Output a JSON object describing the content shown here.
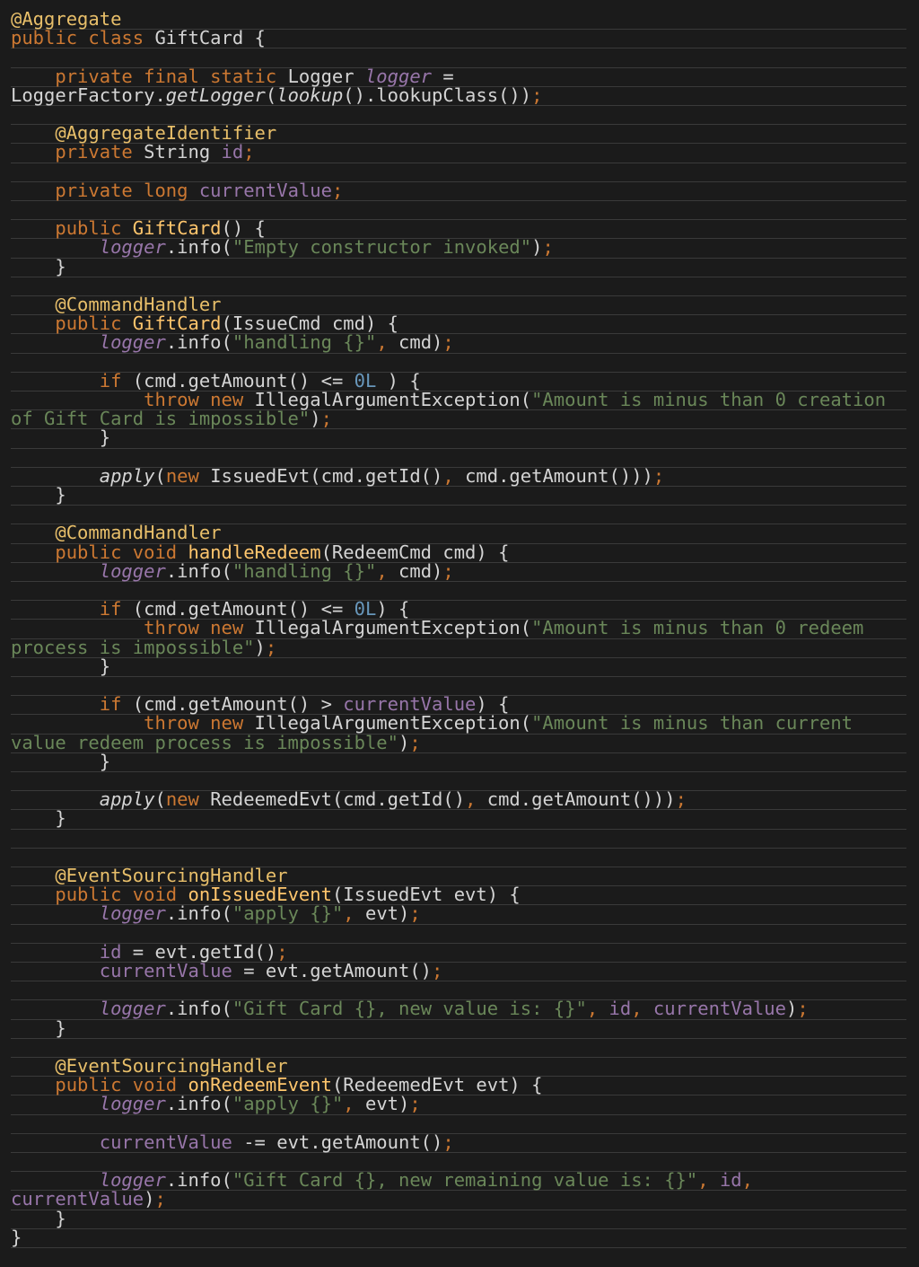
{
  "editor": {
    "language": "java",
    "theme": {
      "background": "#1b1b1b",
      "rule": "#3a3a3a",
      "plain": "#d4d4d4",
      "keyword": "#cc7832",
      "annotation": "#e8bf6a",
      "method_decl": "#ffc66d",
      "field": "#9876aa",
      "string": "#6a8759",
      "number": "#6897bb"
    },
    "lines": [
      [
        {
          "t": "ann",
          "s": "@Aggregate"
        }
      ],
      [
        {
          "t": "kw",
          "s": "public class "
        },
        {
          "t": "plain",
          "s": "GiftCard {"
        }
      ],
      [],
      [
        {
          "t": "plain",
          "s": "    "
        },
        {
          "t": "kw",
          "s": "private final static "
        },
        {
          "t": "plain",
          "s": "Logger "
        },
        {
          "t": "static",
          "s": "logger"
        },
        {
          "t": "plain",
          "s": " ="
        }
      ],
      [
        {
          "t": "plain",
          "s": "LoggerFactory."
        },
        {
          "t": "ital",
          "s": "getLogger"
        },
        {
          "t": "plain",
          "s": "("
        },
        {
          "t": "ital",
          "s": "lookup"
        },
        {
          "t": "plain",
          "s": "().lookupClass())"
        },
        {
          "t": "punct",
          "s": ";"
        }
      ],
      [],
      [
        {
          "t": "plain",
          "s": "    "
        },
        {
          "t": "ann",
          "s": "@AggregateIdentifier"
        }
      ],
      [
        {
          "t": "plain",
          "s": "    "
        },
        {
          "t": "kw",
          "s": "private "
        },
        {
          "t": "plain",
          "s": "String "
        },
        {
          "t": "field",
          "s": "id"
        },
        {
          "t": "punct",
          "s": ";"
        }
      ],
      [],
      [
        {
          "t": "plain",
          "s": "    "
        },
        {
          "t": "kw",
          "s": "private long "
        },
        {
          "t": "field",
          "s": "currentValue"
        },
        {
          "t": "punct",
          "s": ";"
        }
      ],
      [],
      [
        {
          "t": "plain",
          "s": "    "
        },
        {
          "t": "kw",
          "s": "public "
        },
        {
          "t": "fn",
          "s": "GiftCard"
        },
        {
          "t": "plain",
          "s": "() {"
        }
      ],
      [
        {
          "t": "plain",
          "s": "        "
        },
        {
          "t": "static",
          "s": "logger"
        },
        {
          "t": "plain",
          "s": ".info("
        },
        {
          "t": "str",
          "s": "\"Empty constructor invoked\""
        },
        {
          "t": "plain",
          "s": ")"
        },
        {
          "t": "punct",
          "s": ";"
        }
      ],
      [
        {
          "t": "plain",
          "s": "    }"
        }
      ],
      [],
      [
        {
          "t": "plain",
          "s": "    "
        },
        {
          "t": "ann",
          "s": "@CommandHandler"
        }
      ],
      [
        {
          "t": "plain",
          "s": "    "
        },
        {
          "t": "kw",
          "s": "public "
        },
        {
          "t": "fn",
          "s": "GiftCard"
        },
        {
          "t": "plain",
          "s": "(IssueCmd cmd) {"
        }
      ],
      [
        {
          "t": "plain",
          "s": "        "
        },
        {
          "t": "static",
          "s": "logger"
        },
        {
          "t": "plain",
          "s": ".info("
        },
        {
          "t": "str",
          "s": "\"handling {}\""
        },
        {
          "t": "punct",
          "s": ", "
        },
        {
          "t": "plain",
          "s": "cmd)"
        },
        {
          "t": "punct",
          "s": ";"
        }
      ],
      [],
      [
        {
          "t": "plain",
          "s": "        "
        },
        {
          "t": "kw",
          "s": "if "
        },
        {
          "t": "plain",
          "s": "(cmd.getAmount() <= "
        },
        {
          "t": "num",
          "s": "0L"
        },
        {
          "t": "plain",
          "s": " ) {"
        }
      ],
      [
        {
          "t": "plain",
          "s": "            "
        },
        {
          "t": "kw",
          "s": "throw new "
        },
        {
          "t": "plain",
          "s": "IllegalArgumentException("
        },
        {
          "t": "str",
          "s": "\"Amount is minus than 0 creation"
        }
      ],
      [
        {
          "t": "str",
          "s": "of Gift Card is impossible\""
        },
        {
          "t": "plain",
          "s": ")"
        },
        {
          "t": "punct",
          "s": ";"
        }
      ],
      [
        {
          "t": "plain",
          "s": "        }"
        }
      ],
      [],
      [
        {
          "t": "plain",
          "s": "        "
        },
        {
          "t": "ital",
          "s": "apply"
        },
        {
          "t": "plain",
          "s": "("
        },
        {
          "t": "kw",
          "s": "new "
        },
        {
          "t": "plain",
          "s": "IssuedEvt(cmd.getId()"
        },
        {
          "t": "punct",
          "s": ", "
        },
        {
          "t": "plain",
          "s": "cmd.getAmount()))"
        },
        {
          "t": "punct",
          "s": ";"
        }
      ],
      [
        {
          "t": "plain",
          "s": "    }"
        }
      ],
      [],
      [
        {
          "t": "plain",
          "s": "    "
        },
        {
          "t": "ann",
          "s": "@CommandHandler"
        }
      ],
      [
        {
          "t": "plain",
          "s": "    "
        },
        {
          "t": "kw",
          "s": "public void "
        },
        {
          "t": "fn",
          "s": "handleRedeem"
        },
        {
          "t": "plain",
          "s": "(RedeemCmd cmd) {"
        }
      ],
      [
        {
          "t": "plain",
          "s": "        "
        },
        {
          "t": "static",
          "s": "logger"
        },
        {
          "t": "plain",
          "s": ".info("
        },
        {
          "t": "str",
          "s": "\"handling {}\""
        },
        {
          "t": "punct",
          "s": ", "
        },
        {
          "t": "plain",
          "s": "cmd)"
        },
        {
          "t": "punct",
          "s": ";"
        }
      ],
      [],
      [
        {
          "t": "plain",
          "s": "        "
        },
        {
          "t": "kw",
          "s": "if "
        },
        {
          "t": "plain",
          "s": "(cmd.getAmount() <= "
        },
        {
          "t": "num",
          "s": "0L"
        },
        {
          "t": "plain",
          "s": ") {"
        }
      ],
      [
        {
          "t": "plain",
          "s": "            "
        },
        {
          "t": "kw",
          "s": "throw new "
        },
        {
          "t": "plain",
          "s": "IllegalArgumentException("
        },
        {
          "t": "str",
          "s": "\"Amount is minus than 0 redeem"
        }
      ],
      [
        {
          "t": "str",
          "s": "process is impossible\""
        },
        {
          "t": "plain",
          "s": ")"
        },
        {
          "t": "punct",
          "s": ";"
        }
      ],
      [
        {
          "t": "plain",
          "s": "        }"
        }
      ],
      [],
      [
        {
          "t": "plain",
          "s": "        "
        },
        {
          "t": "kw",
          "s": "if "
        },
        {
          "t": "plain",
          "s": "(cmd.getAmount() > "
        },
        {
          "t": "field",
          "s": "currentValue"
        },
        {
          "t": "plain",
          "s": ") {"
        }
      ],
      [
        {
          "t": "plain",
          "s": "            "
        },
        {
          "t": "kw",
          "s": "throw new "
        },
        {
          "t": "plain",
          "s": "IllegalArgumentException("
        },
        {
          "t": "str",
          "s": "\"Amount is minus than current"
        }
      ],
      [
        {
          "t": "str",
          "s": "value redeem process is impossible\""
        },
        {
          "t": "plain",
          "s": ")"
        },
        {
          "t": "punct",
          "s": ";"
        }
      ],
      [
        {
          "t": "plain",
          "s": "        }"
        }
      ],
      [],
      [
        {
          "t": "plain",
          "s": "        "
        },
        {
          "t": "ital",
          "s": "apply"
        },
        {
          "t": "plain",
          "s": "("
        },
        {
          "t": "kw",
          "s": "new "
        },
        {
          "t": "plain",
          "s": "RedeemedEvt(cmd.getId()"
        },
        {
          "t": "punct",
          "s": ", "
        },
        {
          "t": "plain",
          "s": "cmd.getAmount()))"
        },
        {
          "t": "punct",
          "s": ";"
        }
      ],
      [
        {
          "t": "plain",
          "s": "    }"
        }
      ],
      [],
      [],
      [
        {
          "t": "plain",
          "s": "    "
        },
        {
          "t": "ann",
          "s": "@EventSourcingHandler"
        }
      ],
      [
        {
          "t": "plain",
          "s": "    "
        },
        {
          "t": "kw",
          "s": "public void "
        },
        {
          "t": "fn",
          "s": "onIssuedEvent"
        },
        {
          "t": "plain",
          "s": "(IssuedEvt evt) {"
        }
      ],
      [
        {
          "t": "plain",
          "s": "        "
        },
        {
          "t": "static",
          "s": "logger"
        },
        {
          "t": "plain",
          "s": ".info("
        },
        {
          "t": "str",
          "s": "\"apply {}\""
        },
        {
          "t": "punct",
          "s": ", "
        },
        {
          "t": "plain",
          "s": "evt)"
        },
        {
          "t": "punct",
          "s": ";"
        }
      ],
      [],
      [
        {
          "t": "plain",
          "s": "        "
        },
        {
          "t": "field",
          "s": "id"
        },
        {
          "t": "plain",
          "s": " = evt.getId()"
        },
        {
          "t": "punct",
          "s": ";"
        }
      ],
      [
        {
          "t": "plain",
          "s": "        "
        },
        {
          "t": "field",
          "s": "currentValue"
        },
        {
          "t": "plain",
          "s": " = evt.getAmount()"
        },
        {
          "t": "punct",
          "s": ";"
        }
      ],
      [],
      [
        {
          "t": "plain",
          "s": "        "
        },
        {
          "t": "static",
          "s": "logger"
        },
        {
          "t": "plain",
          "s": ".info("
        },
        {
          "t": "str",
          "s": "\"Gift Card {}, new value is: {}\""
        },
        {
          "t": "punct",
          "s": ", "
        },
        {
          "t": "field",
          "s": "id"
        },
        {
          "t": "punct",
          "s": ", "
        },
        {
          "t": "field",
          "s": "currentValue"
        },
        {
          "t": "plain",
          "s": ")"
        },
        {
          "t": "punct",
          "s": ";"
        }
      ],
      [
        {
          "t": "plain",
          "s": "    }"
        }
      ],
      [],
      [
        {
          "t": "plain",
          "s": "    "
        },
        {
          "t": "ann",
          "s": "@EventSourcingHandler"
        }
      ],
      [
        {
          "t": "plain",
          "s": "    "
        },
        {
          "t": "kw",
          "s": "public void "
        },
        {
          "t": "fn",
          "s": "onRedeemEvent"
        },
        {
          "t": "plain",
          "s": "(RedeemedEvt evt) {"
        }
      ],
      [
        {
          "t": "plain",
          "s": "        "
        },
        {
          "t": "static",
          "s": "logger"
        },
        {
          "t": "plain",
          "s": ".info("
        },
        {
          "t": "str",
          "s": "\"apply {}\""
        },
        {
          "t": "punct",
          "s": ", "
        },
        {
          "t": "plain",
          "s": "evt)"
        },
        {
          "t": "punct",
          "s": ";"
        }
      ],
      [],
      [
        {
          "t": "plain",
          "s": "        "
        },
        {
          "t": "field",
          "s": "currentValue"
        },
        {
          "t": "plain",
          "s": " -= evt.getAmount()"
        },
        {
          "t": "punct",
          "s": ";"
        }
      ],
      [],
      [
        {
          "t": "plain",
          "s": "        "
        },
        {
          "t": "static",
          "s": "logger"
        },
        {
          "t": "plain",
          "s": ".info("
        },
        {
          "t": "str",
          "s": "\"Gift Card {}, new remaining value is: {}\""
        },
        {
          "t": "punct",
          "s": ", "
        },
        {
          "t": "field",
          "s": "id"
        },
        {
          "t": "punct",
          "s": ","
        }
      ],
      [
        {
          "t": "field",
          "s": "currentValue"
        },
        {
          "t": "plain",
          "s": ")"
        },
        {
          "t": "punct",
          "s": ";"
        }
      ],
      [
        {
          "t": "plain",
          "s": "    }"
        }
      ],
      [
        {
          "t": "plain",
          "s": "}"
        }
      ]
    ]
  }
}
